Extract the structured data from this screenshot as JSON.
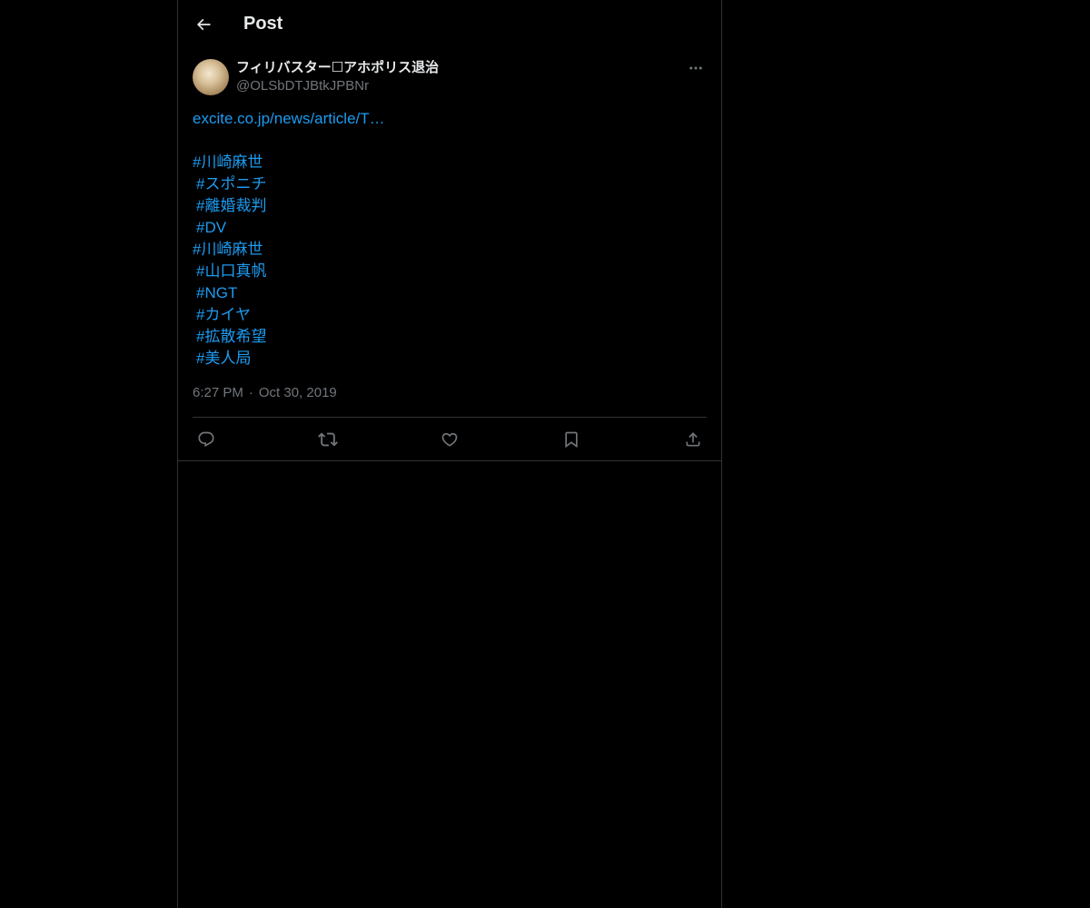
{
  "header": {
    "title": "Post"
  },
  "post": {
    "author": {
      "display_name": "フィリバスター☐アホポリス退治",
      "handle": "@OLSbDTJBtkJPBNr"
    },
    "link_text": "excite.co.jp/news/article/T…",
    "hashtags": [
      {
        "text": "#川崎麻世",
        "indent": false
      },
      {
        "text": "#スポニチ",
        "indent": true
      },
      {
        "text": "#離婚裁判",
        "indent": true
      },
      {
        "text": "#DV",
        "indent": true
      },
      {
        "text": "#川崎麻世",
        "indent": false
      },
      {
        "text": "#山口真帆",
        "indent": true
      },
      {
        "text": "#NGT",
        "indent": true
      },
      {
        "text": "#カイヤ",
        "indent": true
      },
      {
        "text": "#拡散希望",
        "indent": true
      },
      {
        "text": "#美人局",
        "indent": true
      }
    ],
    "time": "6:27 PM",
    "separator": "·",
    "date": "Oct 30, 2019"
  },
  "actions": [
    {
      "name": "reply-button",
      "icon": "reply-icon"
    },
    {
      "name": "repost-button",
      "icon": "repost-icon"
    },
    {
      "name": "like-button",
      "icon": "heart-icon"
    },
    {
      "name": "bookmark-button",
      "icon": "bookmark-icon"
    },
    {
      "name": "share-button",
      "icon": "share-icon"
    }
  ],
  "colors": {
    "background": "#000000",
    "text": "#e7e9ea",
    "secondary_text": "#71767b",
    "link": "#1d9bf0",
    "border": "#2f3336"
  }
}
